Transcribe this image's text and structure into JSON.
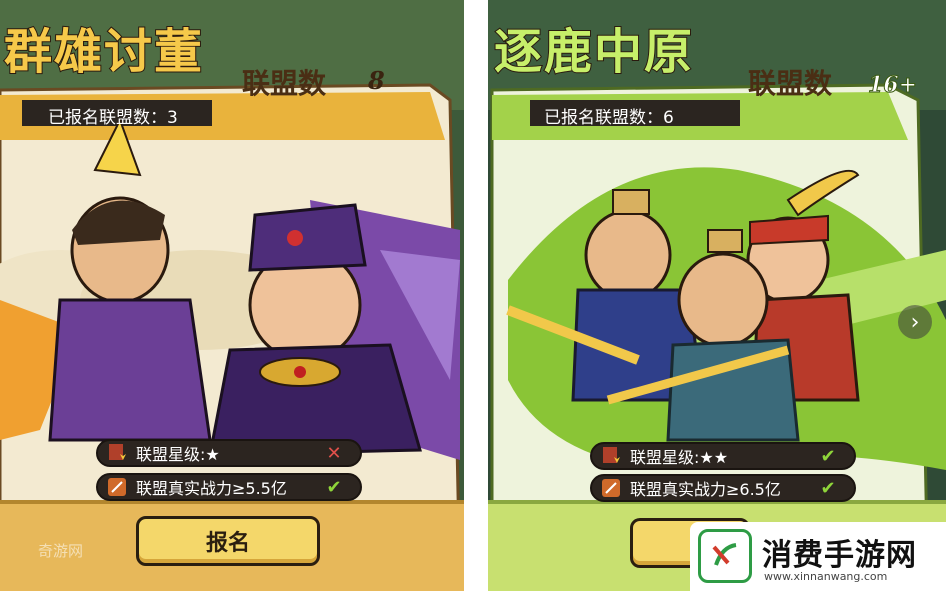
{
  "left_card": {
    "title": "群雄讨董",
    "subtitle": "联盟数",
    "count": "8",
    "registered": "已报名联盟数：3",
    "requirements": [
      {
        "text": "联盟星级:★",
        "met": false,
        "mark": "✕",
        "icon": "alliance-flag-icon"
      },
      {
        "text": "联盟真实战力≥5.5亿",
        "met": true,
        "mark": "✔",
        "icon": "battle-power-icon"
      }
    ],
    "signup_label": "报名",
    "colors": {
      "header": "#e9b33c",
      "frame": "#f3ead1",
      "title": "#f6c94a"
    }
  },
  "right_card": {
    "title": "逐鹿中原",
    "subtitle": "联盟数",
    "count": "16+",
    "registered": "已报名联盟数：6",
    "requirements": [
      {
        "text": "联盟星级:★★",
        "met": true,
        "mark": "✔",
        "icon": "alliance-flag-icon"
      },
      {
        "text": "联盟真实战力≥6.5亿",
        "met": true,
        "mark": "✔",
        "icon": "battle-power-icon"
      }
    ],
    "colors": {
      "header": "#a3d24a",
      "frame": "#eef3dc",
      "title": "#c7ef6a"
    }
  },
  "nav": {
    "next_icon": "chevron-right-icon"
  },
  "watermark": {
    "name": "消费手游网",
    "url": "www.xinnanwang.com",
    "corner_text": "奇游网",
    "colors": {
      "logo": "#2e9c45",
      "accent": "#d23c2c"
    }
  }
}
